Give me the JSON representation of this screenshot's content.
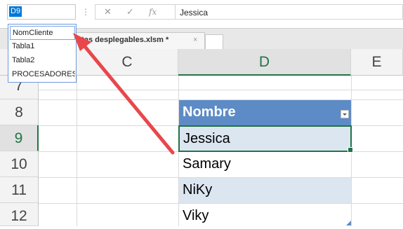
{
  "formula_bar": {
    "namebox_value": "D9",
    "more_glyph": "⋮",
    "cancel_glyph": "✕",
    "enter_glyph": "✓",
    "fx_glyph": "fx",
    "formula_value": "Jessica"
  },
  "name_dropdown": {
    "items": [
      "NomCliente",
      "Tabla1",
      "Tabla2",
      "PROCESADORES"
    ]
  },
  "workbook_tab": {
    "label": "istas desplegables.xlsm *",
    "close_glyph": "×"
  },
  "grid": {
    "columns": [
      "C",
      "D",
      "E"
    ],
    "active_column": "D",
    "rows": [
      "7",
      "8",
      "9",
      "10",
      "11",
      "12"
    ],
    "active_row": "9",
    "table": {
      "header": "Nombre",
      "values": [
        "Jessica",
        "Samary",
        "NiKy",
        "Viky"
      ]
    }
  },
  "colors": {
    "accent_green": "#217346",
    "table_header": "#5d8bc6",
    "band": "#dce6f1",
    "arrow": "#e8474c"
  },
  "icons": [
    "filter-dropdown-icon",
    "close-icon",
    "red-arrow-annotation"
  ]
}
